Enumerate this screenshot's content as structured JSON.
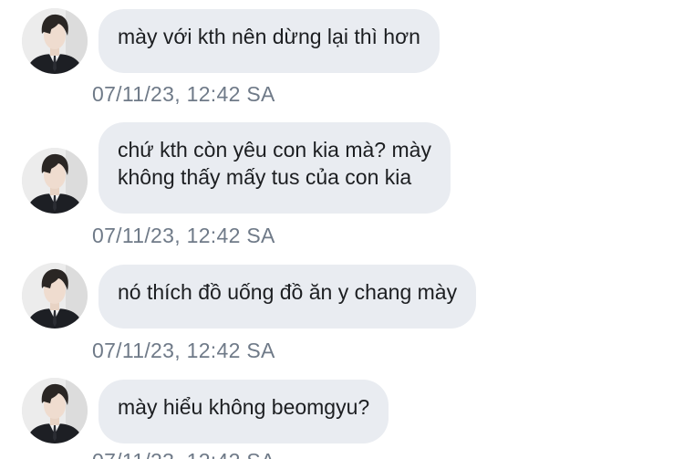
{
  "conversation": {
    "messages": [
      {
        "lines": [
          "mày với kth nên dừng lại thì hơn"
        ],
        "timestamp": "07/11/23, 12:42 SA",
        "avatar": "user-avatar-photo"
      },
      {
        "lines": [
          "chứ kth còn yêu con kia mà? mày",
          "không thấy mấy tus của con kia"
        ],
        "timestamp": "07/11/23, 12:42 SA",
        "avatar": "user-avatar-photo"
      },
      {
        "lines": [
          "nó thích đồ uống đồ ăn y chang mày"
        ],
        "timestamp": "07/11/23, 12:42 SA",
        "avatar": "user-avatar-photo"
      },
      {
        "lines": [
          "mày hiểu không beomgyu?"
        ],
        "timestamp": "07/11/23, 12:42 SA",
        "avatar": "user-avatar-photo"
      }
    ]
  },
  "colors": {
    "bubble_background": "#e9ecf1",
    "message_text": "#1c1e21",
    "timestamp_text": "#6f7a88",
    "page_background": "#ffffff"
  }
}
